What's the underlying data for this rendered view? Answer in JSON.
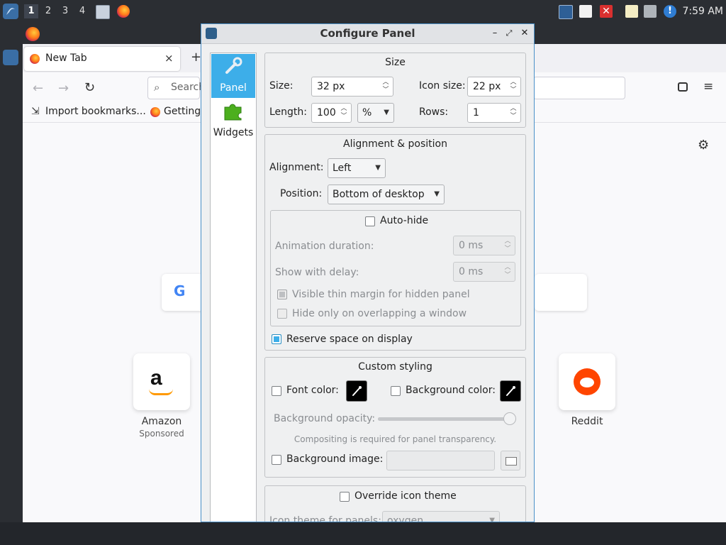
{
  "top_panel": {
    "workspaces": [
      "1",
      "2",
      "3",
      "4"
    ],
    "clock": "7:59 AM"
  },
  "firefox": {
    "tab_title": "New Tab",
    "new_tab_symbol": "+",
    "close_symbol": "×",
    "search_placeholder": "Search",
    "bookmarks": [
      "Import bookmarks...",
      "Getting"
    ],
    "tiles": [
      {
        "label": "Amazon",
        "sub": "Sponsored"
      },
      {
        "label": "Reddit",
        "sub": ""
      }
    ]
  },
  "dialog": {
    "title": "Configure Panel",
    "sidebar": [
      {
        "label": "Panel",
        "selected": true
      },
      {
        "label": "Widgets",
        "selected": false
      }
    ],
    "size_group": {
      "title": "Size",
      "size_label": "Size:",
      "size_value": "32 px",
      "icon_size_label": "Icon size:",
      "icon_size_value": "22 px",
      "length_label": "Length:",
      "length_value": "100",
      "length_unit": "%",
      "rows_label": "Rows:",
      "rows_value": "1"
    },
    "alignment_group": {
      "title": "Alignment & position",
      "alignment_label": "Alignment:",
      "alignment_value": "Left",
      "position_label": "Position:",
      "position_value": "Bottom of desktop",
      "autohide_label": "Auto-hide",
      "animation_label": "Animation duration:",
      "animation_value": "0 ms",
      "delay_label": "Show with delay:",
      "delay_value": "0 ms",
      "thin_margin_label": "Visible thin margin for hidden panel",
      "overlap_label": "Hide only on overlapping a window",
      "reserve_label": "Reserve space on display"
    },
    "styling_group": {
      "title": "Custom styling",
      "font_color_label": "Font color:",
      "bg_color_label": "Background color:",
      "opacity_label": "Background opacity:",
      "opacity_level": 1.0,
      "compositing_hint": "Compositing is required for panel transparency.",
      "bg_image_label": "Background image:"
    },
    "icon_theme_group": {
      "override_label": "Override icon theme",
      "theme_label": "Icon theme for panels:",
      "theme_value": "oxygen"
    }
  },
  "colors": {
    "accent": "#3daee9",
    "panel_bg": "#2b2e33"
  }
}
